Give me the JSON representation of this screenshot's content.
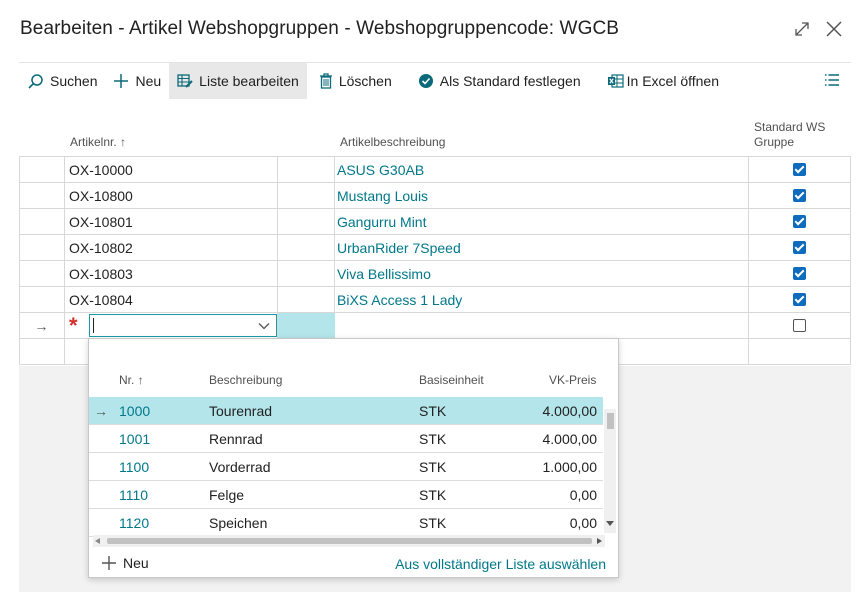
{
  "window": {
    "title": "Bearbeiten - Artikel Webshopgruppen - Webshopgruppencode: WGCB"
  },
  "toolbar": {
    "search": "Suchen",
    "new": "Neu",
    "edit_list": "Liste bearbeiten",
    "delete": "Löschen",
    "set_default": "Als Standard festlegen",
    "open_excel": "In Excel öffnen"
  },
  "grid": {
    "headers": {
      "item_no": "Artikelnr. ↑",
      "description": "Artikelbeschreibung",
      "standard": "Standard WS Gruppe"
    },
    "rows": [
      {
        "item_no": "OX-10000",
        "description": "ASUS G30AB",
        "standard": true
      },
      {
        "item_no": "OX-10800",
        "description": "Mustang Louis",
        "standard": true
      },
      {
        "item_no": "OX-10801",
        "description": "Gangurru Mint",
        "standard": true
      },
      {
        "item_no": "OX-10802",
        "description": "UrbanRider 7Speed",
        "standard": true
      },
      {
        "item_no": "OX-10803",
        "description": "Viva Bellissimo",
        "standard": true
      },
      {
        "item_no": "OX-10804",
        "description": "BiXS Access 1 Lady",
        "standard": true
      }
    ],
    "new_row": {
      "arrow": "→",
      "required_marker": "*",
      "input_value": "",
      "standard": false
    }
  },
  "dropdown": {
    "headers": {
      "nr": "Nr. ↑",
      "description": "Beschreibung",
      "unit": "Basiseinheit",
      "price": "VK-Preis"
    },
    "rows": [
      {
        "nr": "1000",
        "description": "Tourenrad",
        "unit": "STK",
        "price": "4.000,00",
        "selected": true
      },
      {
        "nr": "1001",
        "description": "Rennrad",
        "unit": "STK",
        "price": "4.000,00",
        "selected": false
      },
      {
        "nr": "1100",
        "description": "Vorderrad",
        "unit": "STK",
        "price": "1.000,00",
        "selected": false
      },
      {
        "nr": "1110",
        "description": "Felge",
        "unit": "STK",
        "price": "0,00",
        "selected": false
      },
      {
        "nr": "1120",
        "description": "Speichen",
        "unit": "STK",
        "price": "0,00",
        "selected": false
      }
    ],
    "selected_arrow": "→",
    "new_label": "Neu",
    "full_list_label": "Aus vollständiger Liste auswählen"
  },
  "colors": {
    "accent_teal": "#00788a",
    "selection": "#b3e5ea",
    "checkbox": "#0f6cbd",
    "required": "#d32f2f"
  }
}
